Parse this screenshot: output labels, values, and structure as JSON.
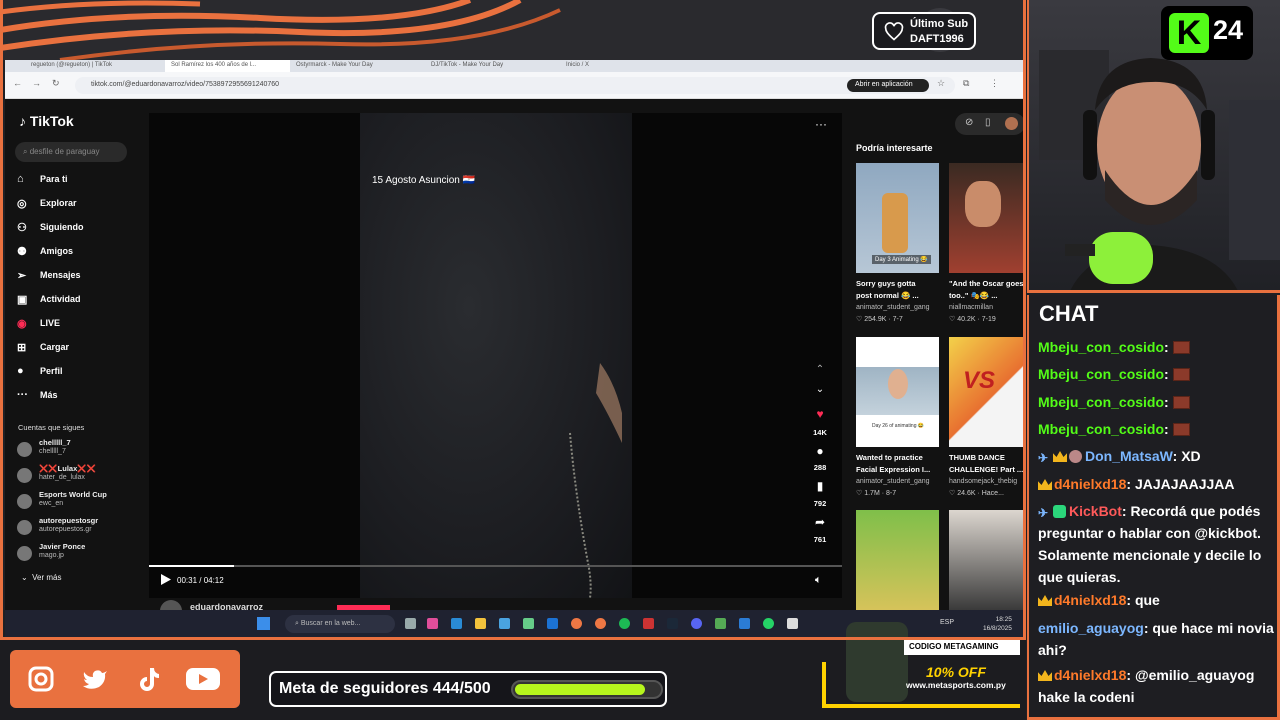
{
  "overlay": {
    "last_sub_title": "Último Sub",
    "last_sub_name": "DAFT1996",
    "goal_text": "Meta de seguidores 444/500",
    "goal_progress": 0.888,
    "kick_badge_number": "24",
    "kick_badge_letter": "K",
    "promo_code": "CODIGO METAGAMING",
    "promo_off": "10% OFF",
    "promo_url": "www.metasports.com.py",
    "social_icons": [
      "instagram-icon",
      "twitter-icon",
      "tiktok-icon",
      "youtube-icon"
    ],
    "accent_color": "#e9713f",
    "kick_green": "#53fc18"
  },
  "browser": {
    "tabs": [
      "regueton (@regueton) | TikTok",
      "Sol Ramírez los 400 años de l...",
      "Ostyrmarck - Make Your Day",
      "DJ/TikTok - Make Your Day",
      "Inicio / X"
    ],
    "url": "tiktok.com/@eduardonavarroz/video/7538972955691240760",
    "open_app": "Abrir en aplicación"
  },
  "tiktok": {
    "logo": "TikTok",
    "search_placeholder": "desfile de paraguay",
    "nav": [
      "Para ti",
      "Explorar",
      "Siguiendo",
      "Amigos",
      "Mensajes",
      "Actividad",
      "LIVE",
      "Cargar",
      "Perfil",
      "Más"
    ],
    "following_title": "Cuentas que sigues",
    "following": [
      {
        "name": "chelllll_7",
        "handle": "chelllll_7"
      },
      {
        "name": "❌❌Lulax❌❌",
        "handle": "hater_de_lulax"
      },
      {
        "name": "Esports World Cup",
        "handle": "ewc_en"
      },
      {
        "name": "autorepuestosgr",
        "handle": "autorepuestos.gr"
      },
      {
        "name": "Javier Ponce",
        "handle": "mago.jp"
      }
    ],
    "see_more": "Ver más",
    "video_caption": "15 Agosto Asuncion 🇵🇾",
    "video_time": "00:31 / 04:12",
    "video_progress": 0.123,
    "likes": "14K",
    "comments": "288",
    "saves": "792",
    "shares": "761",
    "author": "eduardonavarroz",
    "suggest_title": "Podría interesarte",
    "suggestions": [
      {
        "title": "Sorry guys gotta",
        "title2": "post normal 😂 ...",
        "user": "animator_student_gang",
        "stats": "♡ 254.9K · 7-7",
        "thumb_text": "Day 3 Animating 😂"
      },
      {
        "title": "\"And the Oscar goes",
        "title2": "too..\" 🎭😂 ...",
        "user": "niallmacmillan",
        "stats": "♡ 40.2K · 7-19",
        "thumb_text": ""
      },
      {
        "title": "Wanted to practice",
        "title2": "Facial Expression I...",
        "user": "animator_student_gang",
        "stats": "♡ 1.7M · 8-7",
        "thumb_text": "Day 26 of animating 😂"
      },
      {
        "title": "THUMB DANCE",
        "title2": "CHALLENGE! Part ...",
        "user": "handsomejack_thebig",
        "stats": "♡ 24.6K · Hace...",
        "thumb_text": ""
      }
    ]
  },
  "taskbar": {
    "search_placeholder": "Buscar en la web...",
    "lang": "ESP",
    "time": "18:25",
    "date": "16/8/2025"
  },
  "chat": {
    "title": "CHAT",
    "messages": [
      {
        "user": "Mbeju_con_cosido",
        "text": "",
        "style": "nm",
        "badges": "",
        "emote": true
      },
      {
        "user": "Mbeju_con_cosido",
        "text": "",
        "style": "nm",
        "badges": "",
        "emote": true
      },
      {
        "user": "Mbeju_con_cosido",
        "text": "",
        "style": "nm",
        "badges": "",
        "emote": true
      },
      {
        "user": "Mbeju_con_cosido",
        "text": "",
        "style": "nm",
        "badges": "",
        "emote": true
      },
      {
        "user": "Don_MatsaW",
        "text": "XD",
        "style": "blue",
        "badges": "sword-crown-mini",
        "emote": false
      },
      {
        "user": "d4nielxd18",
        "text": "JAJAJAAJJAA",
        "style": "gold",
        "badges": "crown",
        "emote": false
      },
      {
        "user": "KickBot",
        "text": "Recordá que podés preguntar o hablar con @kickbot. Solamente mencionale y decile lo que quieras.",
        "style": "red",
        "badges": "sword-green",
        "emote": false
      },
      {
        "user": "d4nielxd18",
        "text": "que",
        "style": "gold",
        "badges": "crown",
        "emote": false
      },
      {
        "user": "emilio_aguayog",
        "text": "que hace mi novia ahi?",
        "style": "blue",
        "badges": "",
        "emote": false
      },
      {
        "user": "d4nielxd18",
        "text": "@emilio_aguayog hake la codeni",
        "style": "gold",
        "badges": "crown",
        "emote": false
      }
    ]
  }
}
